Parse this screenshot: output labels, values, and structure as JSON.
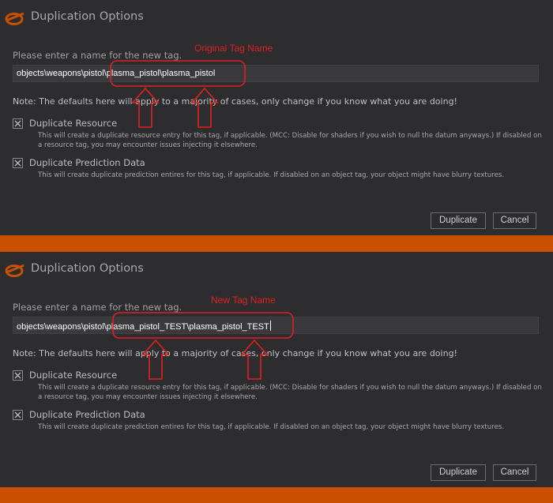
{
  "colors": {
    "accent": "#c85000",
    "panel_bg": "#2d2d30",
    "annotation": "#e02020"
  },
  "icons": {
    "logo": "halo-logo-icon",
    "checkbox": "checkbox-checked-icon",
    "arrow": "up-arrow-icon"
  },
  "dialogs": [
    {
      "title": "Duplication Options",
      "prompt": "Please enter a name for the new tag.",
      "tag_value": "objects\\weapons\\pistol\\plasma_pistol\\plasma_pistol",
      "annotation": "Original Tag Name",
      "note": "Note: The defaults here will apply to a majority of cases, only change if you know what you are doing!",
      "options": [
        {
          "label": "Duplicate Resource",
          "checked": true,
          "description": "This will create a duplicate resource entry for this tag, if applicable. (MCC: Disable for shaders if you wish to null the datum anyways.) If disabled on a resource tag, you may encounter issues injecting it elsewhere."
        },
        {
          "label": "Duplicate Prediction Data",
          "checked": true,
          "description": "This will create duplicate prediction entires for this tag, if applicable. If disabled on an object tag, your object might have blurry textures."
        }
      ],
      "buttons": {
        "duplicate": "Duplicate",
        "cancel": "Cancel"
      }
    },
    {
      "title": "Duplication Options",
      "prompt": "Please enter a name for the new tag.",
      "tag_value": "objects\\weapons\\pistol\\plasma_pistol_TEST\\plasma_pistol_TEST",
      "annotation": "New Tag Name",
      "note": "Note: The defaults here will apply to a majority of cases, only change if you know what you are doing!",
      "options": [
        {
          "label": "Duplicate Resource",
          "checked": true,
          "description": "This will create a duplicate resource entry for this tag, if applicable. (MCC: Disable for shaders if you wish to null the datum anyways.) If disabled on a resource tag, you may encounter issues injecting it elsewhere."
        },
        {
          "label": "Duplicate Prediction Data",
          "checked": true,
          "description": "This will create duplicate prediction entires for this tag, if applicable. If disabled on an object tag, your object might have blurry textures."
        }
      ],
      "buttons": {
        "duplicate": "Duplicate",
        "cancel": "Cancel"
      }
    }
  ]
}
